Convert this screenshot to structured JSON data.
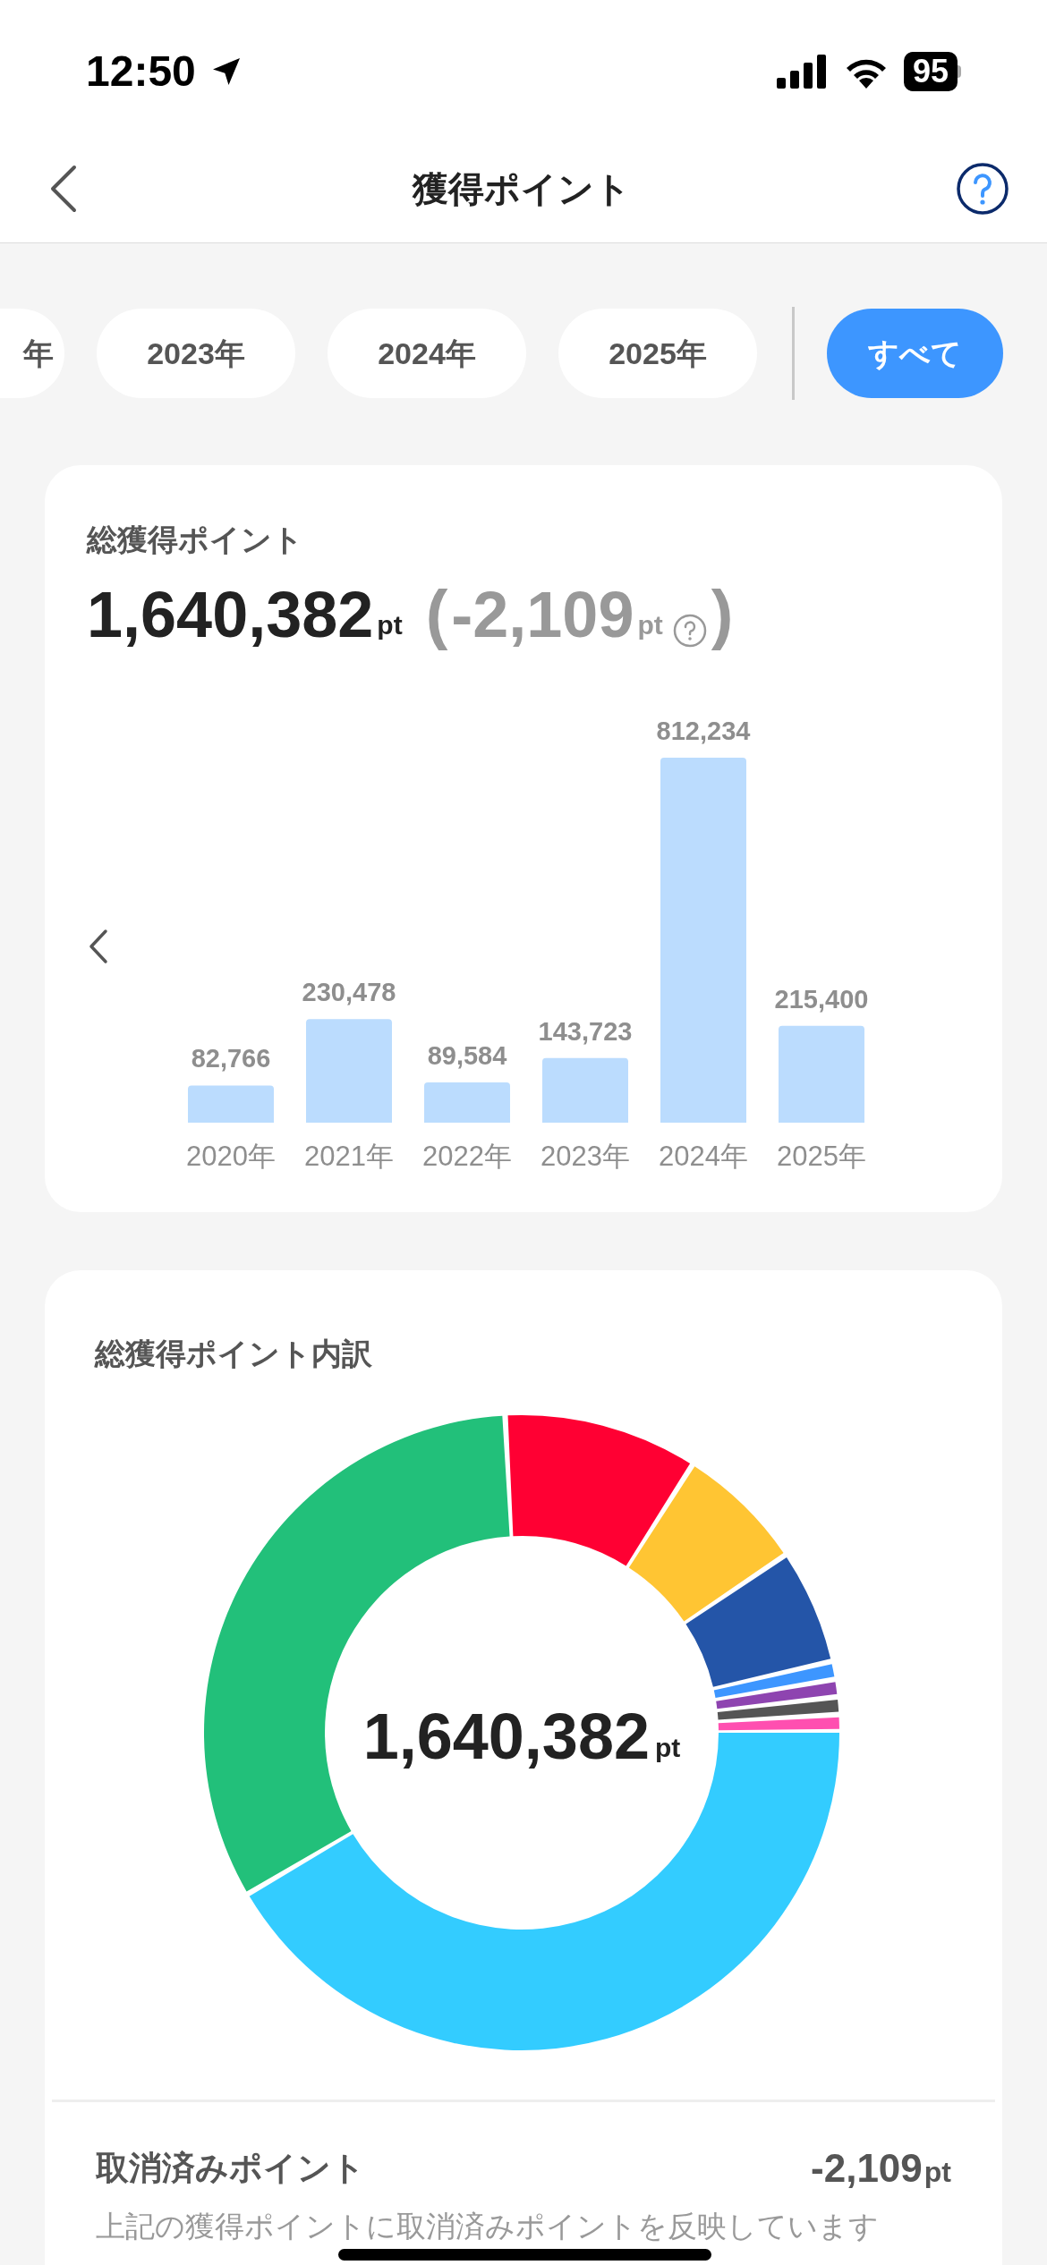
{
  "status_bar": {
    "time": "12:50",
    "battery": "95"
  },
  "nav": {
    "title": "獲得ポイント"
  },
  "filters": {
    "years": [
      {
        "label": "年",
        "selected": false
      },
      {
        "label": "2023年",
        "selected": false
      },
      {
        "label": "2024年",
        "selected": false
      },
      {
        "label": "2025年",
        "selected": false
      }
    ],
    "all": {
      "label": "すべて",
      "selected": true
    }
  },
  "summary": {
    "title": "総獲得ポイント",
    "total": "1,640,382",
    "unit": "pt",
    "open_paren": "(",
    "cancelled": "-2,109",
    "cancelled_unit": "pt",
    "close_paren": ")",
    "chart_data": {
      "type": "bar",
      "categories": [
        "2020年",
        "2021年",
        "2022年",
        "2023年",
        "2024年",
        "2025年"
      ],
      "values": [
        82766,
        230478,
        89584,
        143723,
        812234,
        215400
      ],
      "value_labels": [
        "82,766",
        "230,478",
        "89,584",
        "143,723",
        "812,234",
        "215,400"
      ]
    }
  },
  "breakdown": {
    "title": "総獲得ポイント内訳",
    "center_total": "1,640,382",
    "center_unit": "pt",
    "cancelled_row": {
      "label": "取消済みポイント",
      "value": "-2,109",
      "unit": "pt"
    },
    "note": "上記の獲得ポイントに取消済みポイントを反映しています"
  }
}
